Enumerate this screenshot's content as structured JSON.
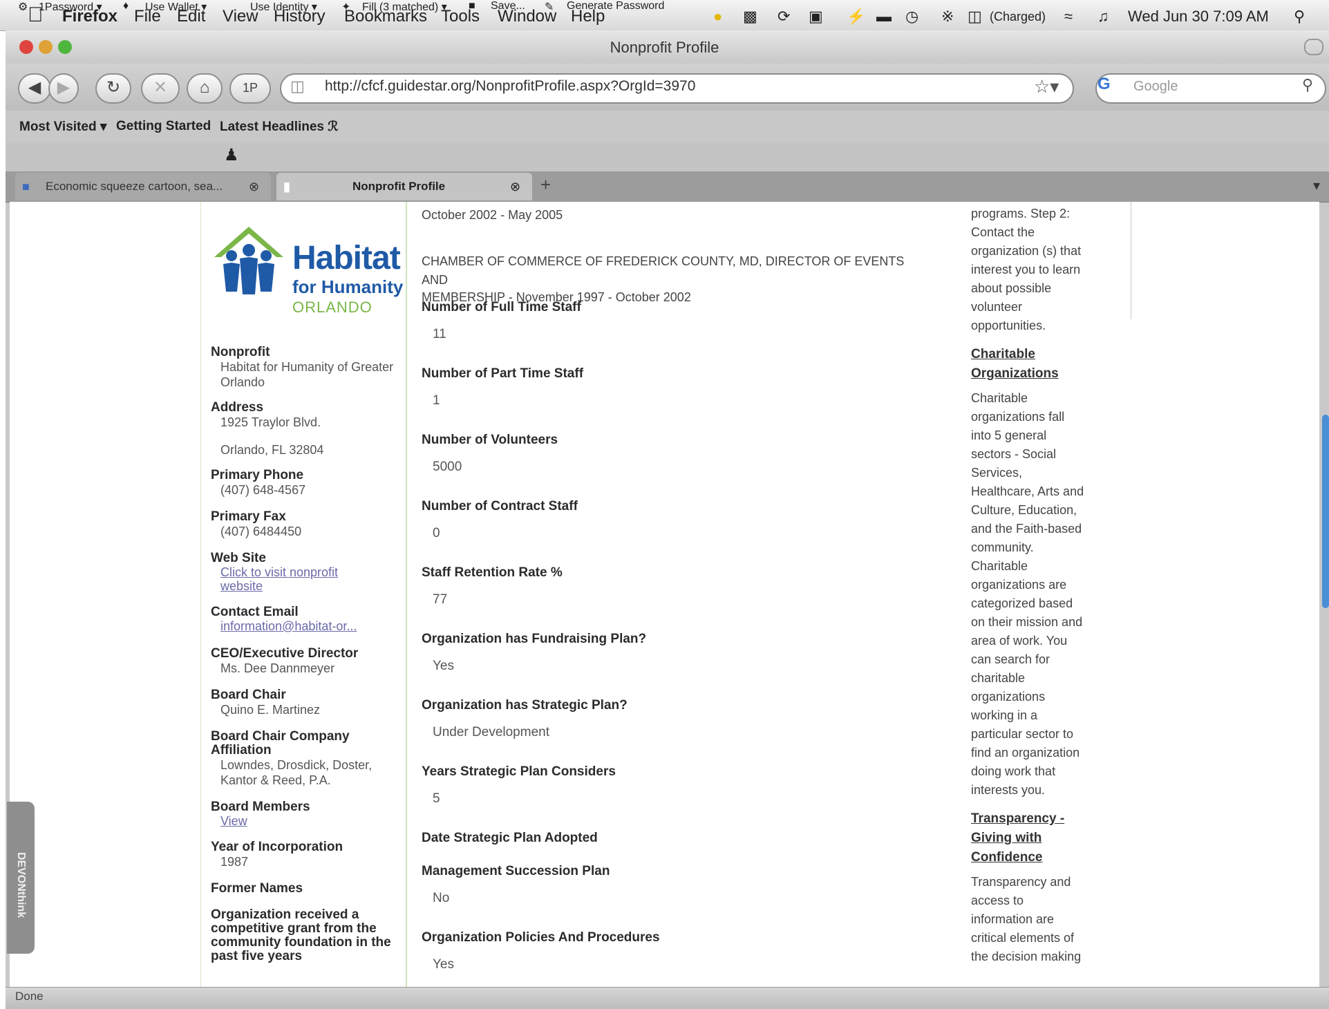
{
  "menubar": {
    "app": "Firefox",
    "items": [
      "File",
      "Edit",
      "View",
      "History",
      "Bookmarks",
      "Tools",
      "Window",
      "Help"
    ],
    "battery": "(Charged)",
    "clock": "Wed Jun 30  7:09 AM"
  },
  "window": {
    "title": "Nonprofit Profile"
  },
  "navbar": {
    "url": "http://cfcf.guidestar.org/NonprofitProfile.aspx?OrgId=3970",
    "search_placeholder": "Google"
  },
  "bookmarks": [
    "Most Visited ▾",
    "Getting Started",
    "Latest Headlines ℛ"
  ],
  "addons": [
    "1Password ▾",
    "Use Wallet ▾",
    "Use Identity ▾",
    "Fill (3 matched) ▾",
    "Save...",
    "Generate Password"
  ],
  "tabs": [
    {
      "label": "Economic squeeze cartoon, sea..."
    },
    {
      "label": "Nonprofit Profile"
    }
  ],
  "logo": {
    "line1": "Habitat",
    "line2": "for Humanity",
    "line3": "ORLANDO"
  },
  "profile": {
    "nonprofit_label": "Nonprofit",
    "nonprofit_value": "Habitat for Humanity of Greater Orlando",
    "address_label": "Address",
    "address_line1": "1925 Traylor Blvd.",
    "address_line2": "Orlando, FL 32804",
    "phone_label": "Primary Phone",
    "phone_value": "(407) 648-4567",
    "fax_label": "Primary Fax",
    "fax_value": "(407) 6484450",
    "website_label": "Web Site",
    "website_link": "Click to visit nonprofit website",
    "email_label": "Contact Email",
    "email_link": "information@habitat-or...",
    "ceo_label": "CEO/Executive Director",
    "ceo_value": "Ms. Dee Dannmeyer",
    "chair_label": "Board Chair",
    "chair_value": "Quino E. Martinez",
    "affil_label": "Board Chair Company Affiliation",
    "affil_value": "Lowndes, Drosdick, Doster, Kantor & Reed, P.A.",
    "members_label": "Board Members",
    "members_link": "View",
    "year_label": "Year of Incorporation",
    "year_value": "1987",
    "former_label": "Former Names",
    "grant_label": "Organization received a competitive grant from the community foundation in the past five years"
  },
  "main": {
    "top_dates": "October 2002 - May 2005",
    "chamber_line1": "CHAMBER OF COMMERCE OF FREDERICK COUNTY, MD, DIRECTOR OF EVENTS AND",
    "chamber_line2": "MEMBERSHIP - November 1997 - October 2002",
    "fields": [
      {
        "label": "Number of Full Time Staff",
        "value": "11"
      },
      {
        "label": "Number of Part Time Staff",
        "value": "1"
      },
      {
        "label": "Number of Volunteers",
        "value": "5000"
      },
      {
        "label": "Number of Contract Staff",
        "value": "0"
      },
      {
        "label": "Staff Retention Rate %",
        "value": "77"
      },
      {
        "label": "Organization has Fundraising Plan?",
        "value": "Yes"
      },
      {
        "label": "Organization has Strategic Plan?",
        "value": "Under Development"
      },
      {
        "label": "Years Strategic Plan Considers",
        "value": "5"
      },
      {
        "label": "Date Strategic Plan Adopted",
        "value": ""
      },
      {
        "label": "Management Succession Plan",
        "value": "No"
      },
      {
        "label": "Organization Policies And Procedures",
        "value": "Yes"
      }
    ]
  },
  "sidebar": {
    "intro_lines": [
      "programs. Step 2:",
      "Contact the",
      "organization (s) that",
      "interest you to learn",
      "about possible",
      "volunteer",
      "opportunities."
    ],
    "charitable_heading": [
      "Charitable",
      "Organizations"
    ],
    "charitable_lines": [
      "Charitable",
      "organizations fall",
      "into 5 general",
      "sectors - Social",
      "Services,",
      "Healthcare, Arts and",
      "Culture, Education,",
      "and the Faith-based",
      "community.",
      "Charitable",
      "organizations are",
      "categorized based",
      "on their mission and",
      "area of work. You",
      "can search for",
      "charitable",
      "organizations",
      "working in a",
      "particular sector to",
      "find an organization",
      "doing work that",
      "interests you."
    ],
    "transparency_heading": [
      "Transparency -",
      "Giving with",
      "Confidence"
    ],
    "transparency_lines": [
      "Transparency and",
      "access to",
      "information are",
      "critical elements of",
      "the decision making"
    ]
  },
  "status": "Done",
  "devon": "DEVONthink",
  "colors": {
    "habitat_blue": "#1f5aa6",
    "habitat_green": "#7ab648",
    "link": "#6a6aa8"
  }
}
